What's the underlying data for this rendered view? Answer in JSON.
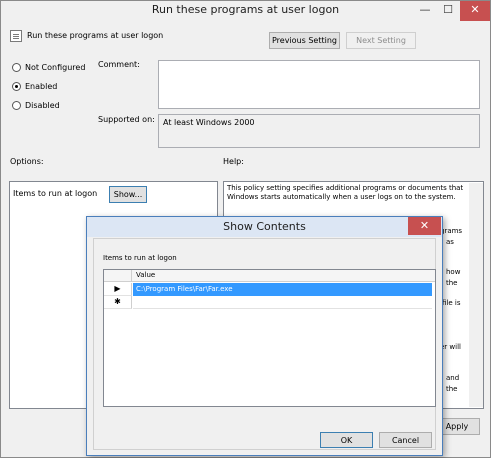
{
  "window": {
    "title": "Run these programs at user logon",
    "minimize": "—",
    "maximize": "☐",
    "close": "✕"
  },
  "policy": {
    "name": "Run these programs at user logon",
    "previous_setting": "Previous Setting",
    "next_setting": "Next Setting"
  },
  "state": {
    "not_configured": "Not Configured",
    "enabled": "Enabled",
    "disabled": "Disabled",
    "selected": "Enabled"
  },
  "comment": {
    "label": "Comment:",
    "value": ""
  },
  "supported": {
    "label": "Supported on:",
    "value": "At least Windows 2000"
  },
  "options": {
    "label": "Options:",
    "item_label": "Items to run at logon",
    "show_button": "Show..."
  },
  "help": {
    "label": "Help:",
    "text": "This policy setting specifies additional programs or documents that Windows starts automatically when a user logs on to the system.",
    "fragments": [
      "grams",
      "as",
      "how",
      "the",
      "file is",
      "er will",
      "and",
      "the"
    ]
  },
  "apply_button": "Apply",
  "dialog": {
    "title": "Show Contents",
    "close": "✕",
    "caption": "Items to run at logon",
    "column": "Value",
    "rows": [
      {
        "marker": "▶",
        "value": "C:\\Program Files\\Far\\Far.exe"
      },
      {
        "marker": "✱",
        "value": ""
      }
    ],
    "ok": "OK",
    "cancel": "Cancel"
  }
}
